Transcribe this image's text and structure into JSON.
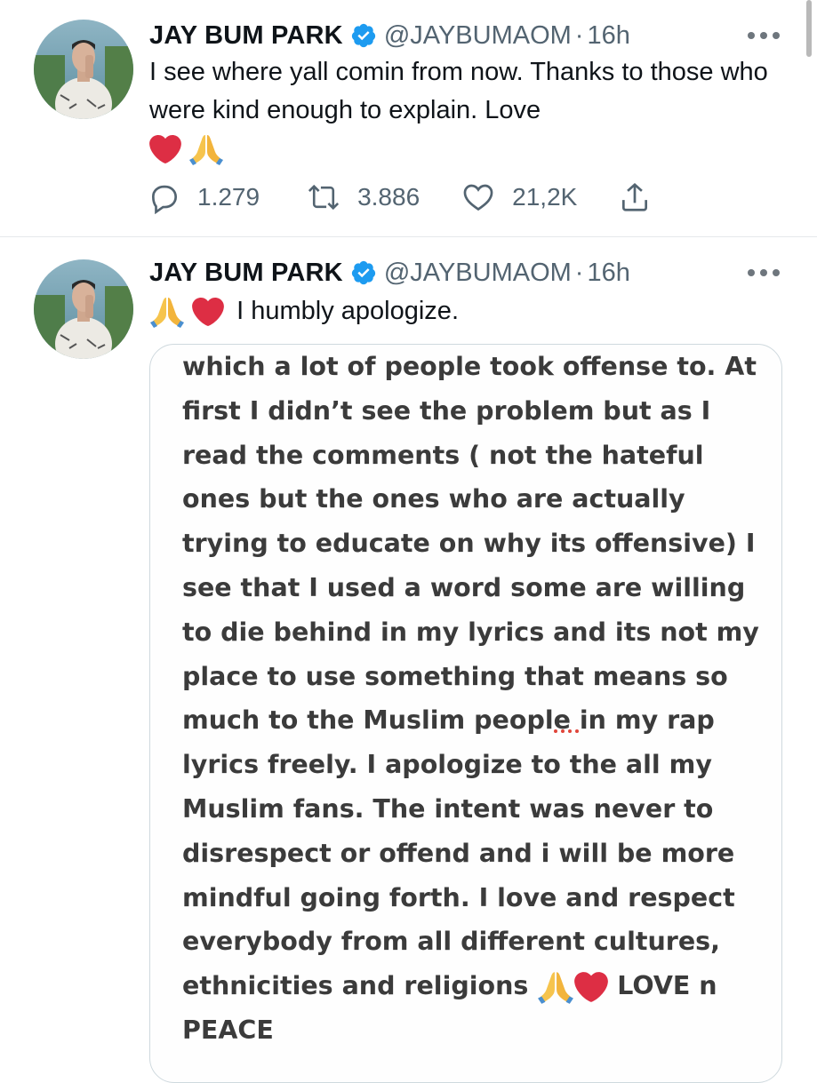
{
  "tweets": [
    {
      "author_name": "JAY BUM PARK",
      "handle": "@JAYBUMAOM",
      "separator": "·",
      "time": "16h",
      "text": "I see where yall comin from now. Thanks to those who were kind enough to explain. Love",
      "emojis": [
        "red-heart",
        "folded-hands"
      ],
      "reply_count": "1.279",
      "retweet_count": "3.886",
      "like_count": "21,2K"
    },
    {
      "author_name": "JAY BUM PARK",
      "handle": "@JAYBUMAOM",
      "separator": "·",
      "time": "16h",
      "text": "I humbly apologize.",
      "emojis": [
        "folded-hands",
        "red-heart"
      ],
      "image_text": "which a lot of people took offense to. At\nfirst I didn’t see the problem but as I\nread the comments ( not the hateful\nones but the ones who are actually\ntrying to educate on why its offensive) I\nsee that I used a word some are willing\nto die behind in my lyrics and its not my\nplace to use something that means so\nmuch to the Muslim people in my rap\nlyrics freely.  I apologize to the all my\nMuslim fans. The intent was never to\ndisrespect or offend and i will be more\nmindful going forth. I love and respect\neverybody from all different cultures,\nethnicities and religions",
      "image_text_end": "LOVE n\nPEACE"
    }
  ],
  "colors": {
    "verified": "#1d9bf0",
    "secondary_text": "#536471",
    "heart": "#e0245e"
  }
}
